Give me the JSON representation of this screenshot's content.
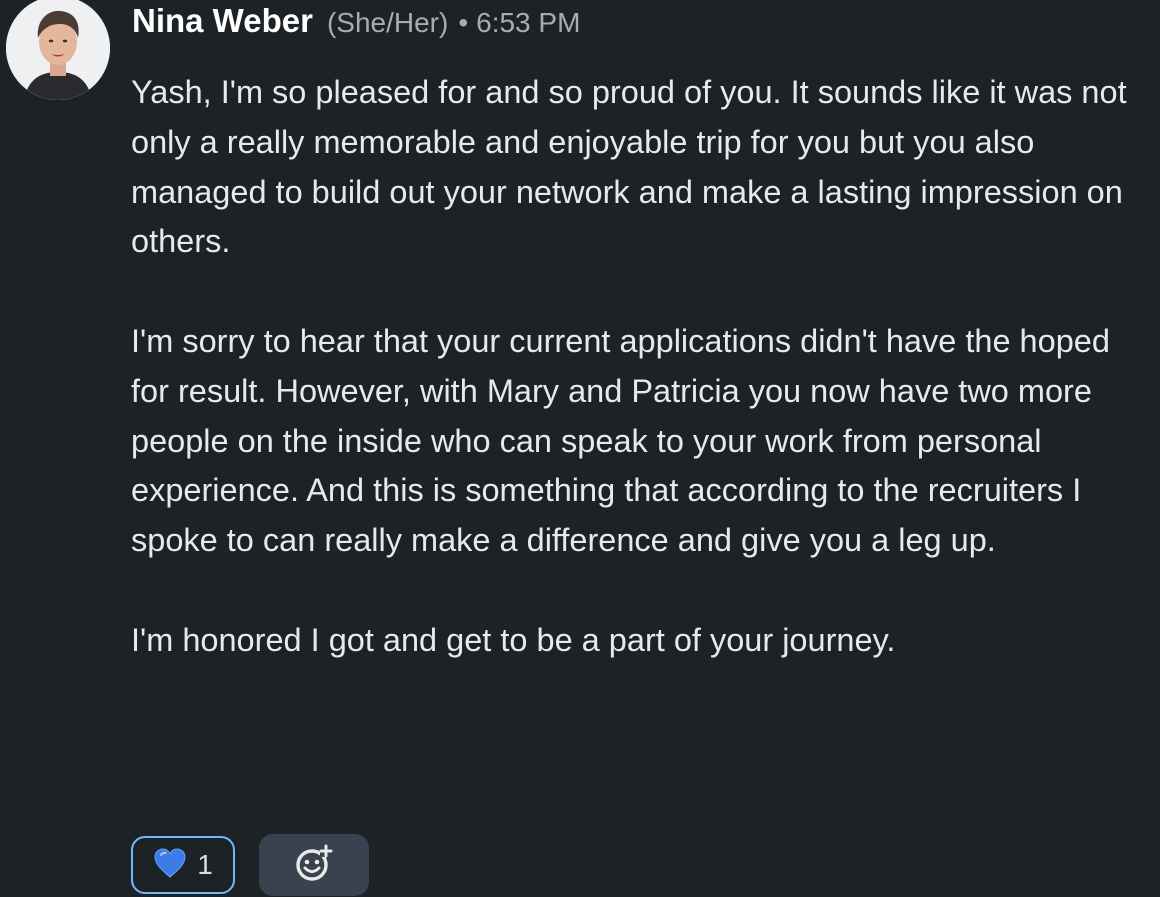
{
  "message": {
    "sender_name": "Nina Weber",
    "pronouns": "(She/Her)",
    "separator": "•",
    "timestamp": "6:53 PM",
    "paragraphs": [
      "Yash, I'm so pleased for and so proud of you. It sounds like it was not only a really memorable and enjoyable trip for you but you also managed to build out your network and make a lasting impression on others.",
      "I'm sorry to hear that your current applications didn't have the hoped for result. However, with Mary and Patricia you now have two more people on the inside who can speak to your work from personal experience. And this is something that according to the recruiters I spoke to can really make a difference and give you a leg up.",
      "I'm honored I got and get to be a part of your journey."
    ]
  },
  "reactions": {
    "items": [
      {
        "icon": "blue-heart-icon",
        "count": "1",
        "selected": true,
        "accent": "#71b7fb"
      }
    ],
    "add_reaction_icon": "add-emoji-icon"
  },
  "colors": {
    "background": "#1d2226",
    "text": "#e9e9e9",
    "muted": "#a8acb0",
    "heart": "#3d7be8",
    "add_reaction_bg": "#38434f"
  }
}
